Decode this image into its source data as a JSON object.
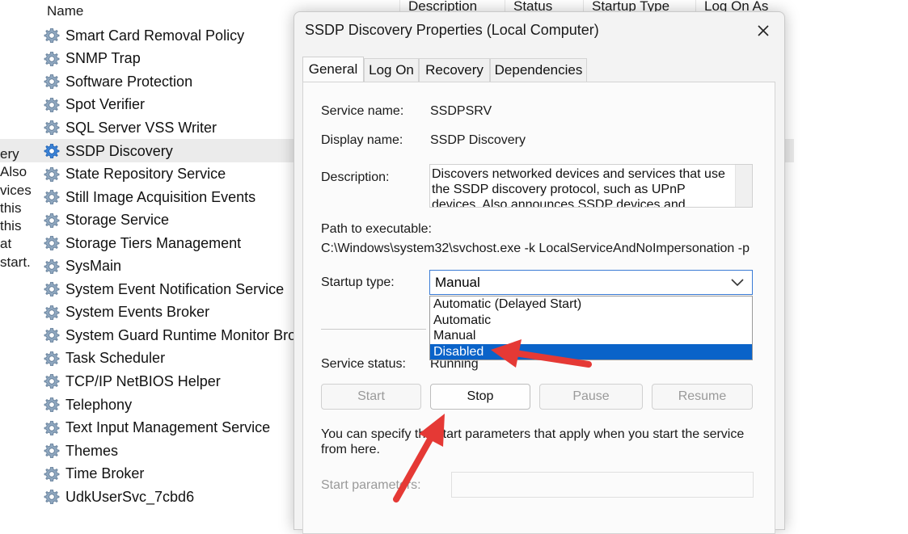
{
  "background": {
    "columns": {
      "name": "Name",
      "description": "Description",
      "status": "Status",
      "startup_type": "Startup Type",
      "log_on_as": "Log On As"
    },
    "left_fragment": [
      "ery",
      "Also",
      "vices",
      " this",
      "",
      "this",
      "at",
      "start."
    ],
    "services": [
      {
        "name": "Smart Card Removal Policy"
      },
      {
        "name": "SNMP Trap"
      },
      {
        "name": "Software Protection"
      },
      {
        "name": "Spot Verifier"
      },
      {
        "name": "SQL Server VSS Writer"
      },
      {
        "name": "SSDP Discovery",
        "selected": true
      },
      {
        "name": "State Repository Service"
      },
      {
        "name": "Still Image Acquisition Events"
      },
      {
        "name": "Storage Service"
      },
      {
        "name": "Storage Tiers Management"
      },
      {
        "name": "SysMain"
      },
      {
        "name": "System Event Notification Service"
      },
      {
        "name": "System Events Broker"
      },
      {
        "name": "System Guard Runtime Monitor Brok"
      },
      {
        "name": "Task Scheduler"
      },
      {
        "name": "TCP/IP NetBIOS Helper"
      },
      {
        "name": "Telephony"
      },
      {
        "name": "Text Input Management Service"
      },
      {
        "name": "Themes"
      },
      {
        "name": "Time Broker"
      },
      {
        "name": "UdkUserSvc_7cbd6"
      }
    ]
  },
  "dialog": {
    "title": "SSDP Discovery Properties (Local Computer)",
    "tabs": [
      "General",
      "Log On",
      "Recovery",
      "Dependencies"
    ],
    "active_tab": "General",
    "service_name_label": "Service name:",
    "service_name": "SSDPSRV",
    "display_name_label": "Display name:",
    "display_name": "SSDP Discovery",
    "description_label": "Description:",
    "description": "Discovers networked devices and services that use the SSDP discovery protocol, such as UPnP devices. Also announces SSDP devices and services running",
    "path_label": "Path to executable:",
    "path": "C:\\Windows\\system32\\svchost.exe -k LocalServiceAndNoImpersonation -p",
    "startup_type_label": "Startup type:",
    "startup_type_value": "Manual",
    "startup_options": [
      "Automatic (Delayed Start)",
      "Automatic",
      "Manual",
      "Disabled"
    ],
    "highlighted_option": "Disabled",
    "service_status_label": "Service status:",
    "service_status": "Running",
    "buttons": {
      "start": "Start",
      "stop": "Stop",
      "pause": "Pause",
      "resume": "Resume"
    },
    "hint_line1": "You can specify the start parameters that apply when you start the service",
    "hint_line2": "from here.",
    "start_params_label": "Start parameters:"
  },
  "colors": {
    "selection_blue": "#0a63c9",
    "annotation_red": "#e53935"
  }
}
